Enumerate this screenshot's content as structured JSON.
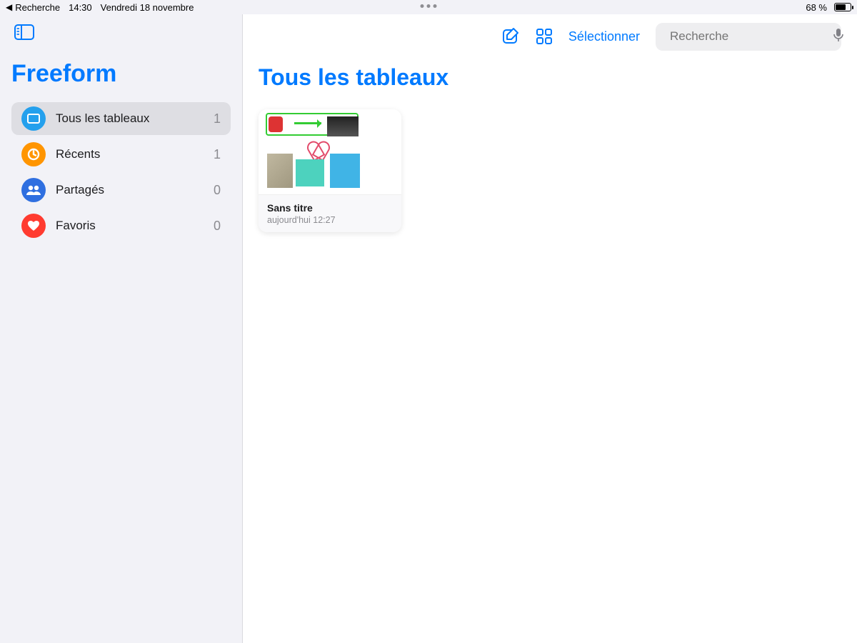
{
  "status": {
    "back_label": "Recherche",
    "time": "14:30",
    "date": "Vendredi 18 novembre",
    "battery_pct": "68 %"
  },
  "sidebar": {
    "app_title": "Freeform",
    "items": [
      {
        "label": "Tous les tableaux",
        "count": "1",
        "icon": "boards-icon",
        "color": "#24a0ed",
        "selected": true
      },
      {
        "label": "Récents",
        "count": "1",
        "icon": "clock-icon",
        "color": "#ff9500",
        "selected": false
      },
      {
        "label": "Partagés",
        "count": "0",
        "icon": "people-icon",
        "color": "#2f6fe0",
        "selected": false
      },
      {
        "label": "Favoris",
        "count": "0",
        "icon": "heart-icon",
        "color": "#ff3b30",
        "selected": false
      }
    ]
  },
  "toolbar": {
    "select_label": "Sélectionner",
    "search_placeholder": "Recherche"
  },
  "main": {
    "heading": "Tous les tableaux",
    "boards": [
      {
        "title": "Sans titre",
        "subtitle": "aujourd'hui 12:27"
      }
    ]
  }
}
